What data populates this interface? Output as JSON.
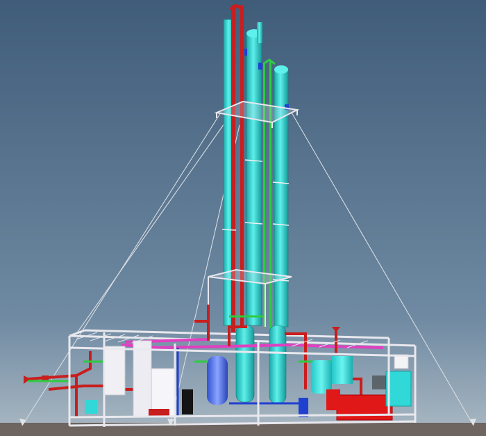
{
  "viewport": {
    "sky_top": "#3f5c79",
    "sky_bottom": "#a5b4c0",
    "ground": "#6e6460"
  },
  "colors": {
    "column": "#27d6cf",
    "column_dark": "#1aa8a8",
    "pipe_red": "#c81e1e",
    "pipe_green": "#2ecc40",
    "pipe_magenta": "#e040c0",
    "frame": "#e8e8ee",
    "blue": "#2040d0",
    "equipment_red": "#e01818",
    "equipment_cyan": "#30d8d8",
    "guy_wire": "#d8dde2"
  },
  "icons": {
    "guy_anchor": "arrow-anchor-icon"
  }
}
